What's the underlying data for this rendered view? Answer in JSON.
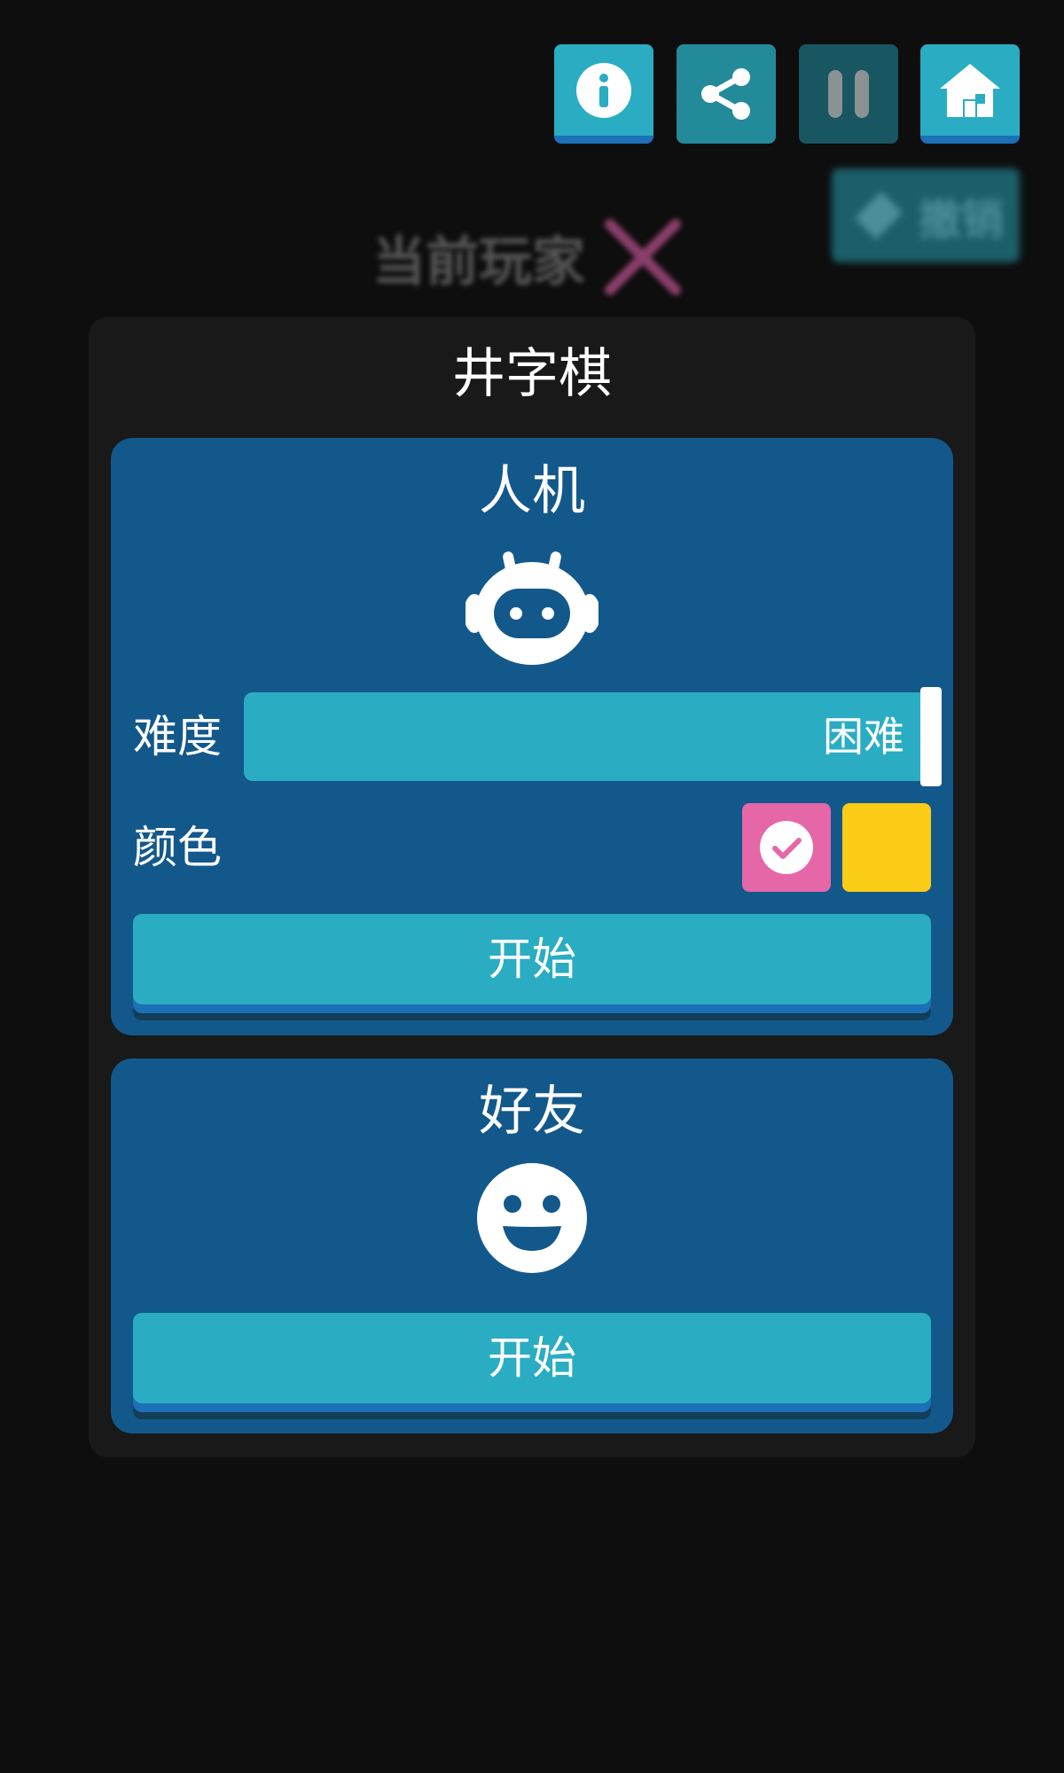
{
  "header": {
    "buttons": [
      {
        "id": "info",
        "icon": "info-icon"
      },
      {
        "id": "share",
        "icon": "share-icon"
      },
      {
        "id": "pause",
        "icon": "pause-icon"
      },
      {
        "id": "home",
        "icon": "home-icon"
      }
    ],
    "undo_label": "撤销",
    "undo_icon": "ticket-icon",
    "current_player_label": "当前玩家",
    "current_player_mark": "x-mark-icon"
  },
  "dialog": {
    "title": "井字棋",
    "vs_ai": {
      "title": "人机",
      "icon": "robot-icon",
      "difficulty_label": "难度",
      "difficulty_value": "困难",
      "color_label": "颜色",
      "colors": [
        {
          "name": "pink",
          "hex": "#e667a8",
          "selected": true
        },
        {
          "name": "yellow",
          "hex": "#facc15",
          "selected": false
        }
      ],
      "start_label": "开始"
    },
    "vs_friend": {
      "title": "好友",
      "icon": "smiley-icon",
      "start_label": "开始"
    }
  },
  "colors": {
    "background": "#0e0e0e",
    "dialog": "#191919",
    "card": "#13588b",
    "button": "#2aadc2",
    "button_shadow": "#1d6fb8"
  }
}
